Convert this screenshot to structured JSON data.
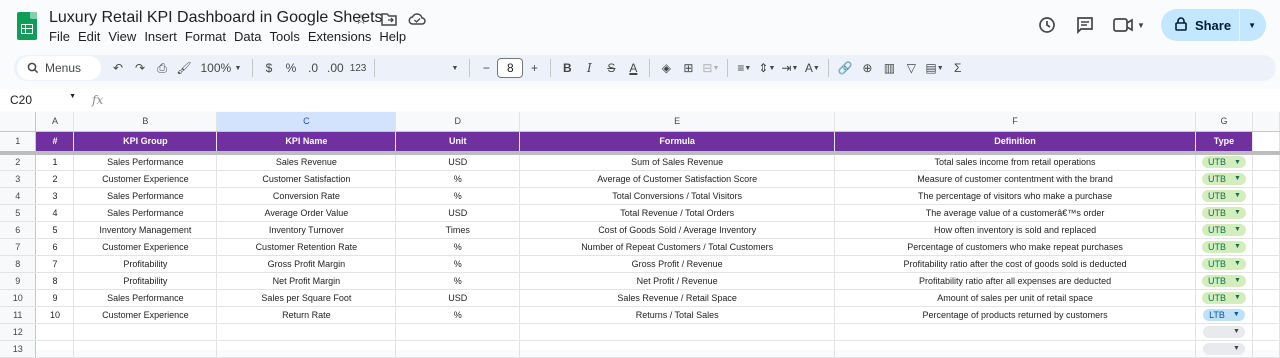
{
  "app": {
    "doc_title": "Luxury Retail KPI Dashboard in Google Sheets",
    "menu": [
      "File",
      "Edit",
      "View",
      "Insert",
      "Format",
      "Data",
      "Tools",
      "Extensions",
      "Help"
    ],
    "share_label": "Share"
  },
  "toolbar": {
    "search_label": "Menus",
    "zoom": "100%",
    "currency": "$",
    "percent": "%",
    "dec_decrease": ".0",
    "dec_increase": ".00",
    "number_format": "123",
    "font_size": "8"
  },
  "formula_bar": {
    "cell_ref": "C20",
    "fx": "fx"
  },
  "columns": [
    "A",
    "B",
    "C",
    "D",
    "E",
    "F",
    "G"
  ],
  "header_row": {
    "row_number": "1",
    "cells": [
      "#",
      "KPI Group",
      "KPI Name",
      "Unit",
      "Formula",
      "Definition",
      "Type"
    ]
  },
  "rows": [
    {
      "rn": "2",
      "num": "1",
      "group": "Sales Performance",
      "name": "Sales Revenue",
      "unit": "USD",
      "formula": "Sum of Sales Revenue",
      "definition": "Total sales income from retail operations",
      "type": "UTB"
    },
    {
      "rn": "3",
      "num": "2",
      "group": "Customer Experience",
      "name": "Customer Satisfaction",
      "unit": "%",
      "formula": "Average of Customer Satisfaction Score",
      "definition": "Measure of customer contentment with the brand",
      "type": "UTB"
    },
    {
      "rn": "4",
      "num": "3",
      "group": "Sales Performance",
      "name": "Conversion Rate",
      "unit": "%",
      "formula": "Total Conversions / Total Visitors",
      "definition": "The percentage of visitors who make a purchase",
      "type": "UTB"
    },
    {
      "rn": "5",
      "num": "4",
      "group": "Sales Performance",
      "name": "Average Order Value",
      "unit": "USD",
      "formula": "Total Revenue / Total Orders",
      "definition": "The average value of a customerâ€™s order",
      "type": "UTB"
    },
    {
      "rn": "6",
      "num": "5",
      "group": "Inventory Management",
      "name": "Inventory Turnover",
      "unit": "Times",
      "formula": "Cost of Goods Sold / Average Inventory",
      "definition": "How often inventory is sold and replaced",
      "type": "UTB"
    },
    {
      "rn": "7",
      "num": "6",
      "group": "Customer Experience",
      "name": "Customer Retention Rate",
      "unit": "%",
      "formula": "Number of Repeat Customers / Total Customers",
      "definition": "Percentage of customers who make repeat purchases",
      "type": "UTB"
    },
    {
      "rn": "8",
      "num": "7",
      "group": "Profitability",
      "name": "Gross Profit Margin",
      "unit": "%",
      "formula": "Gross Profit / Revenue",
      "definition": "Profitability ratio after the cost of goods sold is deducted",
      "type": "UTB"
    },
    {
      "rn": "9",
      "num": "8",
      "group": "Profitability",
      "name": "Net Profit Margin",
      "unit": "%",
      "formula": "Net Profit / Revenue",
      "definition": "Profitability ratio after all expenses are deducted",
      "type": "UTB"
    },
    {
      "rn": "10",
      "num": "9",
      "group": "Sales Performance",
      "name": "Sales per Square Foot",
      "unit": "USD",
      "formula": "Sales Revenue / Retail Space",
      "definition": "Amount of sales per unit of retail space",
      "type": "UTB"
    },
    {
      "rn": "11",
      "num": "10",
      "group": "Customer Experience",
      "name": "Return Rate",
      "unit": "%",
      "formula": "Returns / Total Sales",
      "definition": "Percentage of products returned by customers",
      "type": "LTB"
    }
  ],
  "empty_rows": [
    "12",
    "13"
  ]
}
